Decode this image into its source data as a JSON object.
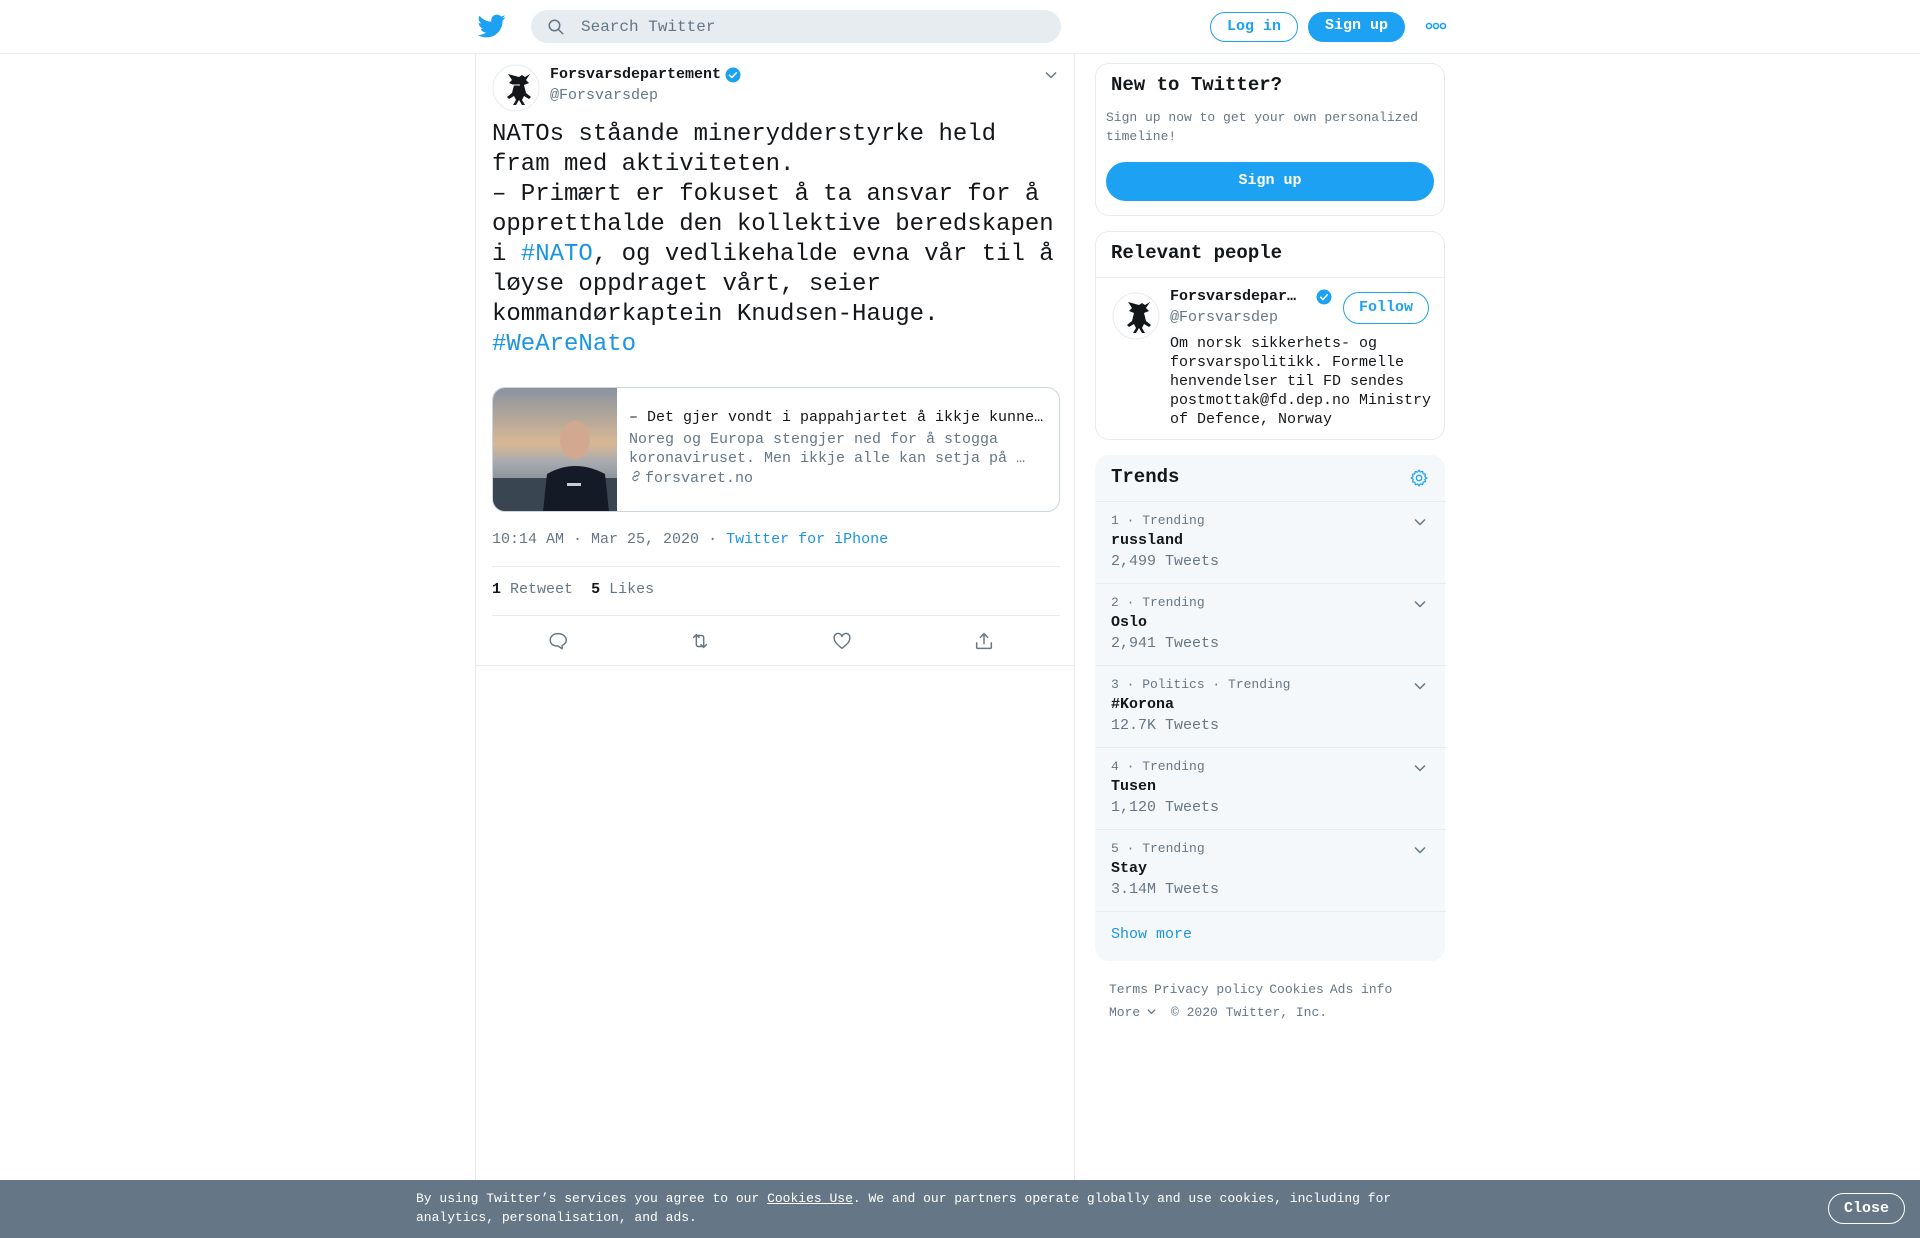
{
  "header": {
    "search_placeholder": "Search Twitter",
    "login_label": "Log in",
    "signup_label": "Sign up"
  },
  "tweet": {
    "author_name": "Forsvarsdepartement",
    "author_handle": "@Forsvarsdep",
    "text_part1": "NATOs ståande minerydderstyrke held fram med aktiviteten.\n– Primært er fokuset å ta ansvar for å oppretthalde den kollektive beredskapen i ",
    "hashtag1": "#NATO",
    "text_part2": ", og vedlikehalde evna vår til å løyse oppdraget vårt, seier kommandørkaptein Knudsen-Hauge.\n",
    "hashtag2": "#WeAreNato",
    "card": {
      "title": "– Det gjer vondt i pappahjartet å ikkje kunne…",
      "description": "Noreg og Europa stengjer ned for å stogga koronaviruset. Men ikkje alle kan setja på …",
      "domain": "forsvaret.no"
    },
    "time": "10:14 AM",
    "date": "Mar 25, 2020",
    "source": "Twitter for iPhone",
    "retweet_count": "1",
    "retweet_label": "Retweet",
    "likes_count": "5",
    "likes_label": "Likes"
  },
  "sidebar": {
    "new_to_twitter": {
      "title": "New to Twitter?",
      "subtitle": "Sign up now to get your own personalized timeline!",
      "button": "Sign up"
    },
    "relevant_people": {
      "title": "Relevant people",
      "name": "Forsvarsdepart…",
      "handle": "@Forsvarsdep",
      "follow_label": "Follow",
      "bio": "Om norsk sikkerhets- og forsvarspolitikk. Formelle henvendelser til FD sendes postmottak@fd.dep.no Ministry of Defence, Norway"
    },
    "trends": {
      "title": "Trends",
      "items": [
        {
          "meta": "1 · Trending",
          "name": "russland",
          "count": "2,499 Tweets"
        },
        {
          "meta": "2 · Trending",
          "name": "Oslo",
          "count": "2,941 Tweets"
        },
        {
          "meta": "3 · Politics · Trending",
          "name": "#Korona",
          "count": "12.7K Tweets"
        },
        {
          "meta": "4 · Trending",
          "name": "Tusen",
          "count": "1,120 Tweets"
        },
        {
          "meta": "5 · Trending",
          "name": "Stay",
          "count": "3.14M Tweets"
        }
      ],
      "show_more": "Show more"
    },
    "footer": {
      "terms": "Terms",
      "privacy": "Privacy policy",
      "cookies": "Cookies",
      "ads": "Ads info",
      "more": "More",
      "copyright": "© 2020 Twitter, Inc."
    }
  },
  "cookie_banner": {
    "text_before": "By using Twitter’s services you agree to our ",
    "link": "Cookies Use",
    "text_after": ". We and our partners operate globally and use cookies, including for analytics, personalisation, and ads.",
    "close_label": "Close"
  },
  "colors": {
    "accent": "#1da1f2",
    "link": "#1b95e0",
    "muted": "#657786",
    "banner": "#657786"
  }
}
